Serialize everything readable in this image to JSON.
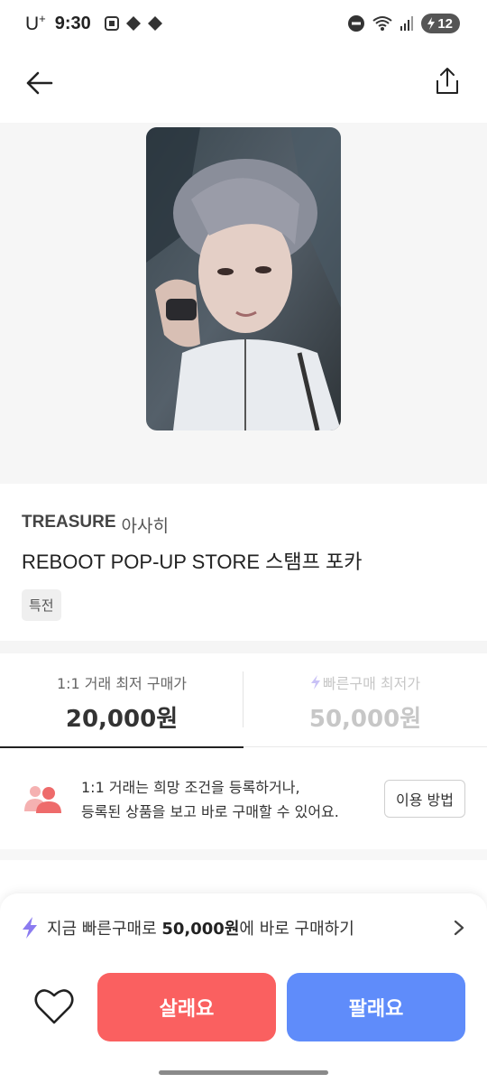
{
  "status_bar": {
    "carrier": "U",
    "carrier_sup": "+",
    "time": "9:30",
    "battery": "12"
  },
  "header": {
    "back_icon": "arrow-left-icon",
    "share_icon": "share-icon"
  },
  "product": {
    "artist": "TREASURE",
    "member": "아사히",
    "title": "REBOOT POP-UP STORE 스탬프 포카",
    "tag": "특전"
  },
  "price_tabs": [
    {
      "label": "1:1 거래 최저 구매가",
      "price": "20,000원",
      "active": true
    },
    {
      "label": "빠른구매 최저가",
      "price": "50,000원",
      "active": false,
      "icon": "lightning-icon"
    }
  ],
  "info": {
    "line1": "1:1 거래는 희망 조건을 등록하거나,",
    "line2": "등록된 상품을 보고 바로 구매할 수 있어요.",
    "button": "이용 방법"
  },
  "quick_buy": {
    "prefix": "지금 빠른구매로 ",
    "price": "50,000원",
    "suffix": "에 바로 구매하기"
  },
  "actions": {
    "buy": "살래요",
    "sell": "팔래요"
  },
  "colors": {
    "buy": "#fa6060",
    "sell": "#5f8cfa",
    "lightning": "#9a8cf5",
    "people_icon": "#f08a8a"
  }
}
